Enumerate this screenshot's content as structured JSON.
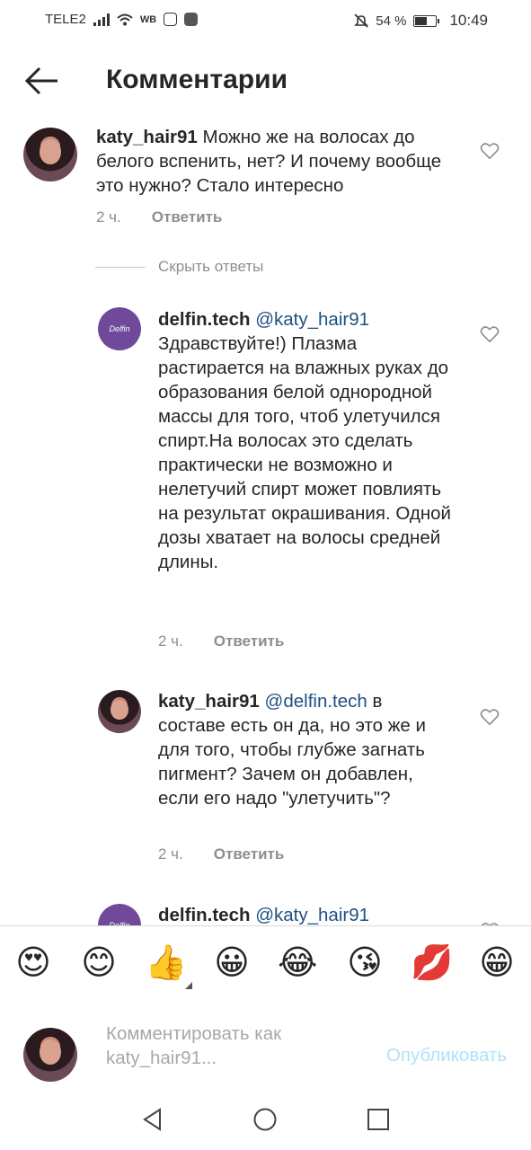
{
  "status": {
    "carrier": "TELE2",
    "wb": "WB",
    "battery_percent": "54 %",
    "time": "10:49"
  },
  "header": {
    "title": "Комментарии"
  },
  "comments": [
    {
      "username": "katy_hair91",
      "mention": "",
      "text": "Можно же на волосах до белого вспенить, нет? И почему вообще это нужно? Стало интересно",
      "time": "2 ч.",
      "reply_label": "Ответить"
    },
    {
      "username": "delfin.tech",
      "mention": "@katy_hair91",
      "text": "Здравствуйте!) Плазма растирается на влажных руках до образования белой однородной массы для того, чтоб улетучился спирт.На волосах это сделать практически не возможно и нелетучий спирт может повлиять на результат окрашивания. Одной дозы хватает на волосы средней длины.",
      "time": "2 ч.",
      "reply_label": "Ответить"
    },
    {
      "username": "katy_hair91",
      "mention": "@delfin.tech",
      "text": "в составе есть он да, но это же и для того, чтобы глубже загнать пигмент? Зачем он добавлен, если его надо \"улетучить\"?",
      "time": "2 ч.",
      "reply_label": "Ответить"
    },
    {
      "username": "delfin.tech",
      "mention": "@katy_hair91"
    }
  ],
  "hide_replies": "Скрыть ответы",
  "emojis": [
    "😍",
    "😊",
    "👍",
    "😀",
    "😂",
    "😘",
    "💋",
    "😁"
  ],
  "compose": {
    "placeholder": "Комментировать как katy_hair91...",
    "publish_label": "Опубликовать"
  },
  "colors": {
    "mention": "#1f4f82",
    "publish_disabled": "#b2dffc",
    "meta_gray": "#8e8e8e"
  },
  "icons": [
    "signal-icon",
    "wifi-icon",
    "instagram-icon",
    "mute-icon",
    "battery-icon",
    "back-arrow-icon",
    "heart-icon",
    "triangle-back-icon",
    "circle-home-icon",
    "square-recents-icon"
  ]
}
